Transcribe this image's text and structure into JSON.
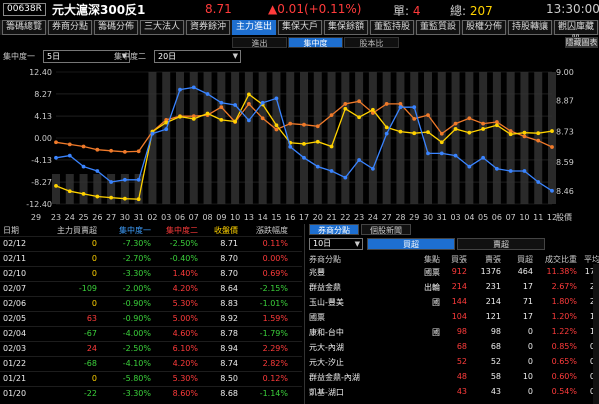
{
  "header": {
    "code": "00638R",
    "name": "元大滬深300反1",
    "price": "8.71",
    "change": "▲0.01(+0.11%)",
    "single_label": "單:",
    "single_value": "4",
    "total_label": "總:",
    "total_value": "207",
    "time": "13:30:00"
  },
  "tabs": [
    "籌碼總覽",
    "券商分點",
    "籌碼分佈",
    "三大法人",
    "資券餘沖",
    "主力進出",
    "集保大戶",
    "集保餘額",
    "董監持股",
    "董監質設",
    "股權分佈",
    "持股轉讓",
    "觀囚庫藏股"
  ],
  "active_tab": 5,
  "subtabs": [
    "進出",
    "集中度",
    "股本比"
  ],
  "active_subtab": 1,
  "hidden_button": "隱藏圖表",
  "selectors": {
    "c1_label": "集中度一",
    "c1_value": "5日",
    "c2_label": "集中度二",
    "c2_value": "20日"
  },
  "chart_data": {
    "type": "line",
    "x": [
      "23",
      "24",
      "25",
      "26",
      "27",
      "30",
      "31",
      "02",
      "03",
      "06",
      "07",
      "08",
      "09",
      "10",
      "13",
      "14",
      "15",
      "16",
      "17",
      "20",
      "21",
      "22",
      "23",
      "24",
      "27",
      "28",
      "29",
      "30",
      "31",
      "03",
      "04",
      "05",
      "06",
      "07",
      "10",
      "11",
      "12"
    ],
    "x_ticks": [
      "29",
      "23",
      "24",
      "25",
      "26",
      "27",
      "30",
      "31",
      "02",
      "03",
      "06",
      "07",
      "08",
      "09",
      "10",
      "13",
      "14",
      "15",
      "16",
      "17",
      "20",
      "21",
      "22",
      "23",
      "24",
      "27",
      "28",
      "29",
      "30",
      "31",
      "03",
      "04",
      "05",
      "06",
      "07",
      "10",
      "11",
      "12"
    ],
    "x_tick_labels": [
      "29",
      "23",
      "24",
      "25",
      "27",
      "30",
      "31",
      "02",
      "03",
      "06",
      "07",
      "08",
      "09",
      "10",
      "13",
      "14",
      "15",
      "16",
      "17",
      "20",
      "21",
      "22",
      "23",
      "24",
      "27",
      "28",
      "29",
      "30",
      "03",
      "04",
      "05",
      "06",
      "07",
      "10",
      "11",
      "12"
    ],
    "ylabel_left_ticks": [
      "12.40",
      "8.27",
      "4.13",
      "0.00",
      "-4.13",
      "-8.27",
      "-12.40"
    ],
    "ylabel_right_ticks": [
      "9.00",
      "8.87",
      "8.73",
      "8.59",
      "8.46"
    ],
    "right_axis_label": "股價",
    "ylim": [
      -12.4,
      12.4
    ],
    "ylim_right": [
      8.4,
      9.0
    ],
    "series": [
      {
        "name": "集中度一",
        "color": "#f07a2a",
        "values": [
          -0.8,
          -1.2,
          -1.6,
          -2.2,
          -2.4,
          -2.6,
          -2.5,
          1.2,
          3.4,
          4.1,
          4.1,
          4.3,
          5.8,
          3.0,
          6.4,
          3.7,
          1.6,
          2.7,
          2.5,
          2.2,
          4.3,
          6.4,
          6.9,
          4.7,
          6.4,
          6.4,
          3.6,
          4.3,
          0.8,
          2.7,
          3.7,
          2.7,
          3.0,
          1.3,
          0.3,
          -0.5,
          -1.7
        ]
      },
      {
        "name": "集中度二",
        "color": "#ffd200",
        "values": [
          -9.0,
          -10.0,
          -10.5,
          -11.0,
          -11.2,
          -11.4,
          -11.5,
          1.2,
          2.9,
          4.0,
          3.6,
          4.6,
          3.4,
          3.1,
          8.2,
          6.3,
          2.4,
          -0.9,
          -1.1,
          -0.7,
          -1.6,
          5.5,
          3.9,
          5.3,
          2.0,
          1.2,
          0.9,
          1.1,
          -0.8,
          1.7,
          1.0,
          1.7,
          2.4,
          0.7,
          1.0,
          0.9,
          1.3
        ]
      },
      {
        "name": "收盤價",
        "color": "#3a84ff",
        "values": [
          8.61,
          8.62,
          8.57,
          8.55,
          8.5,
          8.51,
          8.51,
          8.72,
          8.74,
          8.92,
          8.93,
          8.9,
          8.86,
          8.85,
          8.78,
          8.86,
          8.88,
          8.66,
          8.61,
          8.57,
          8.55,
          8.52,
          8.6,
          8.56,
          8.72,
          8.84,
          8.84,
          8.63,
          8.63,
          8.62,
          8.57,
          8.61,
          8.56,
          8.55,
          8.55,
          8.5,
          8.46
        ]
      }
    ],
    "bars": [
      3,
      3,
      3,
      3,
      3,
      3,
      3,
      12.4,
      12.4,
      12.4,
      12.4,
      12.4,
      12.4,
      12.4,
      12.4,
      12.4,
      12.4,
      12.4,
      12.4,
      12.4,
      12.4,
      12.4,
      12.4,
      12.4,
      12.4,
      12.4,
      12.4,
      12.4,
      12.4,
      12.4,
      12.4,
      12.4,
      12.4,
      12.4,
      12.4,
      12.4,
      12.4
    ]
  },
  "left_table": {
    "headers": [
      "日期",
      "主力買賣超",
      "集中度一",
      "集中度二",
      "收盤價",
      "漲跌幅度"
    ],
    "rows": [
      {
        "date": "02/12",
        "net": "0",
        "c1": "-7.30%",
        "c2": "-2.50%",
        "close": "8.71",
        "pct": "0.11%"
      },
      {
        "date": "02/11",
        "net": "0",
        "c1": "-2.70%",
        "c2": "-0.40%",
        "close": "8.70",
        "pct": "0.00%"
      },
      {
        "date": "02/10",
        "net": "0",
        "c1": "-3.30%",
        "c2": "1.40%",
        "close": "8.70",
        "pct": "0.69%"
      },
      {
        "date": "02/07",
        "net": "-109",
        "c1": "-2.00%",
        "c2": "4.20%",
        "close": "8.64",
        "pct": "-2.15%"
      },
      {
        "date": "02/06",
        "net": "0",
        "c1": "-0.90%",
        "c2": "5.30%",
        "close": "8.83",
        "pct": "-1.01%"
      },
      {
        "date": "02/05",
        "net": "63",
        "c1": "-0.90%",
        "c2": "5.00%",
        "close": "8.92",
        "pct": "1.59%"
      },
      {
        "date": "02/04",
        "net": "-67",
        "c1": "-4.00%",
        "c2": "4.60%",
        "close": "8.78",
        "pct": "-1.79%"
      },
      {
        "date": "02/03",
        "net": "24",
        "c1": "-2.50%",
        "c2": "6.10%",
        "close": "8.94",
        "pct": "2.29%"
      },
      {
        "date": "01/22",
        "net": "-68",
        "c1": "-4.10%",
        "c2": "4.20%",
        "close": "8.74",
        "pct": "2.82%"
      },
      {
        "date": "01/21",
        "net": "0",
        "c1": "-5.80%",
        "c2": "5.30%",
        "close": "8.50",
        "pct": "0.12%"
      },
      {
        "date": "01/20",
        "net": "-22",
        "c1": "-3.30%",
        "c2": "8.60%",
        "close": "8.68",
        "pct": "-1.14%"
      }
    ]
  },
  "right_panel": {
    "tabs": [
      "券商分點",
      "個股新聞"
    ],
    "active_tab": 0,
    "period": "10日",
    "buy_label": "買超",
    "sell_label": "賣超",
    "headers": [
      "券商分點",
      "集點",
      "買張",
      "賣張",
      "買超",
      "成交比重",
      "平均"
    ],
    "rows": [
      {
        "broker": "兆豐",
        "tag": "國票",
        "buy": "912",
        "sell": "1376",
        "net": "464",
        "ratio": "11.38%",
        "avg": "17.."
      },
      {
        "broker": "群益金鼎",
        "tag": "出輪",
        "buy": "214",
        "sell": "231",
        "net": "17",
        "ratio": "2.67%",
        "avg": "2.."
      },
      {
        "broker": "玉山-豐美",
        "tag": "國",
        "buy": "144",
        "sell": "214",
        "net": "71",
        "ratio": "1.80%",
        "avg": "2.."
      },
      {
        "broker": "國票",
        "tag": "",
        "buy": "104",
        "sell": "121",
        "net": "17",
        "ratio": "1.20%",
        "avg": "1.."
      },
      {
        "broker": "康和-台中",
        "tag": "國",
        "buy": "98",
        "sell": "98",
        "net": "0",
        "ratio": "1.22%",
        "avg": "1.."
      },
      {
        "broker": "元大-內湖",
        "tag": "",
        "buy": "68",
        "sell": "68",
        "net": "0",
        "ratio": "0.85%",
        "avg": "0.."
      },
      {
        "broker": "元大-汐止",
        "tag": "",
        "buy": "52",
        "sell": "52",
        "net": "0",
        "ratio": "0.65%",
        "avg": "0.."
      },
      {
        "broker": "群益金鼎-內湖",
        "tag": "",
        "buy": "48",
        "sell": "58",
        "net": "10",
        "ratio": "0.60%",
        "avg": "0.."
      },
      {
        "broker": "凱基-湖口",
        "tag": "",
        "buy": "43",
        "sell": "43",
        "net": "0",
        "ratio": "0.54%",
        "avg": "0.."
      }
    ]
  }
}
